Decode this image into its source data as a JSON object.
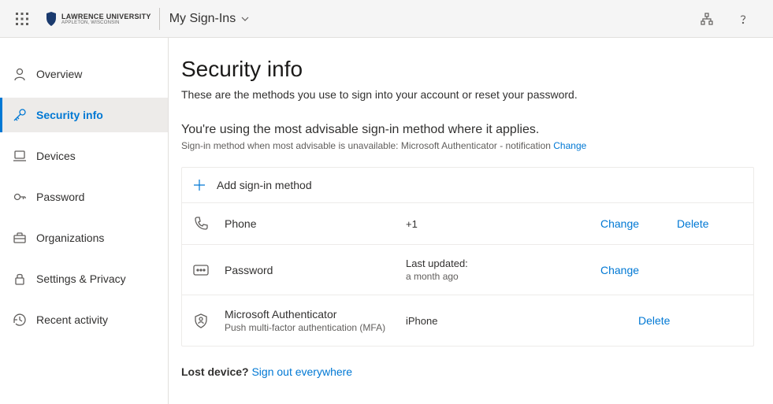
{
  "header": {
    "org_name": "Lawrence University",
    "org_sub": "APPLETON, WISCONSIN",
    "app_title": "My Sign-Ins"
  },
  "sidebar": {
    "items": [
      {
        "label": "Overview"
      },
      {
        "label": "Security info"
      },
      {
        "label": "Devices"
      },
      {
        "label": "Password"
      },
      {
        "label": "Organizations"
      },
      {
        "label": "Settings & Privacy"
      },
      {
        "label": "Recent activity"
      }
    ]
  },
  "page": {
    "title": "Security info",
    "subtitle": "These are the methods you use to sign into your account or reset your password.",
    "advisable": "You're using the most advisable sign-in method where it applies.",
    "advisable_sub_prefix": "Sign-in method when most advisable is unavailable: Microsoft Authenticator - notification ",
    "advisable_change": "Change",
    "add_method": "Add sign-in method",
    "lost_device_prefix": "Lost device? ",
    "lost_device_link": "Sign out everywhere"
  },
  "methods": [
    {
      "name": "Phone",
      "sub": "",
      "detail": "+1",
      "detail_sub": "",
      "change": "Change",
      "delete": "Delete"
    },
    {
      "name": "Password",
      "sub": "",
      "detail": "Last updated:",
      "detail_sub": "a month ago",
      "change": "Change",
      "delete": ""
    },
    {
      "name": "Microsoft Authenticator",
      "sub": "Push multi-factor authentication (MFA)",
      "detail": "iPhone",
      "detail_sub": "",
      "change": "",
      "delete": "Delete"
    }
  ],
  "colors": {
    "accent": "#0078d4"
  }
}
